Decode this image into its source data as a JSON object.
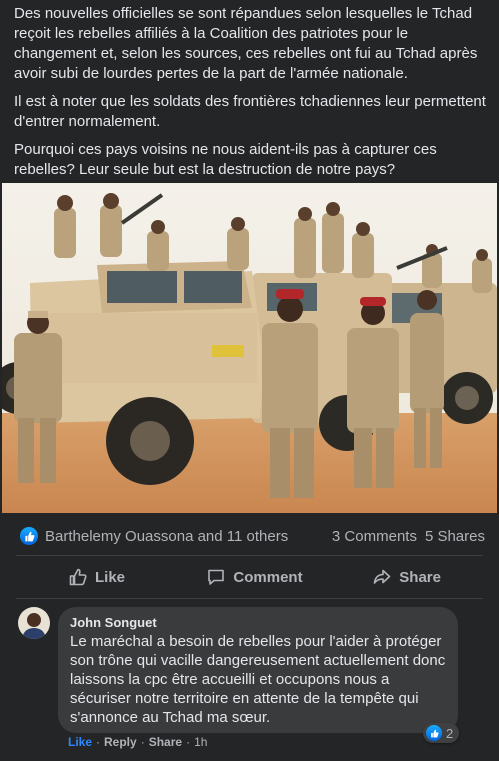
{
  "post": {
    "paragraphs": [
      "Des nouvelles officielles se sont répandues selon lesquelles le Tchad reçoit les rebelles affiliés à la Coalition des patriotes pour le changement et, selon les sources, ces rebelles ont fui au Tchad après avoir subi de lourdes pertes de la part de l'armée nationale.",
      "Il est à noter que les soldats des frontières tchadiennes leur permettent d'entrer normalement.",
      "Pourquoi ces pays voisins ne nous aident-ils pas à capturer ces rebelles? Leur seule but est la destruction de notre pays?"
    ],
    "photo_icon": "photo-soldiers-armored-vehicles"
  },
  "stats": {
    "reactions_label": "Barthelemy Ouassona and 11 others",
    "comments_label": "3 Comments",
    "shares_label": "5 Shares"
  },
  "actions": {
    "like": "Like",
    "comment": "Comment",
    "share": "Share"
  },
  "comment": {
    "author": "John Songuet",
    "text": "Le maréchal a besoin de rebelles pour l'aider à protéger son trône qui vacille dangereusement actuellement donc laissons la cpc être accueilli et occupons nous a sécuriser notre territoire en attente de la tempête qui s'annonce au Tchad ma sœur.",
    "reaction_count": "2",
    "like_label": "Like",
    "reply_label": "Reply",
    "share_label": "Share",
    "time": "1h"
  },
  "colors": {
    "background": "#242526",
    "text": "#e4e6eb",
    "secondary_text": "#b0b3b8",
    "bubble": "#3a3b3c",
    "accent": "#2d88ff"
  }
}
